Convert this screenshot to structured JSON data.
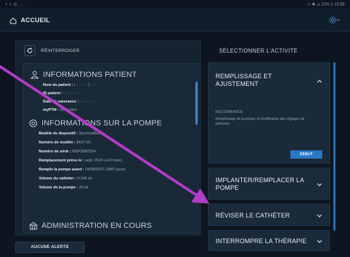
{
  "statusbar": {
    "left": "▪ ▪ ◎ ...",
    "right": "◐ ✱ ⊿ 12% ▯ 15:58"
  },
  "appbar": {
    "title": "ACCUEIL",
    "home_icon": "home-icon",
    "settings_icon": "gear-icon"
  },
  "left": {
    "reinterroger_label": "RÉINTERROGER",
    "patient": {
      "title": "INFORMATIONS PATIENT",
      "rows": [
        {
          "label": "Nom du patient :",
          "value": " ( · · · · · ) · · ·"
        },
        {
          "label": "ID patient :",
          "value": " - - - - - -"
        },
        {
          "label": "Date de naissance :",
          "value": " - - - - - -"
        },
        {
          "label": "myPTM :",
          "value": " Désactivé"
        }
      ]
    },
    "pump": {
      "title": "INFORMATIONS SUR LA POMPE",
      "rows": [
        {
          "label": "Modèle de dispositif :",
          "value": " SynchroMed"
        },
        {
          "label": "Numéro de modèle :",
          "value": " 8637-20"
        },
        {
          "label": "Numéro de série :",
          "value": " NGP358031H"
        },
        {
          "label": "Remplacement prévu le :",
          "value": " sept. 2024 (+63 mois)"
        },
        {
          "label": "Remplir la pompe avant :",
          "value": " 24/06/2027 (2887 jours)"
        },
        {
          "label": "Volume du cathéter :",
          "value": " 0,196 ml"
        },
        {
          "label": "Volume de la pompe :",
          "value": " 20 ml"
        }
      ]
    },
    "admin": {
      "title": "ADMINISTRATION EN COURS"
    },
    "alert_button": "AUCUNE ALERTE"
  },
  "right": {
    "title": "SÉLECTIONNER L'ACTIVITÉ",
    "activities": [
      {
        "label_line1": "REMPLISSAGE ET",
        "label_line2": "AJUSTEMENT",
        "expanded": true,
        "recommended": "RECOMMANDÉ",
        "description": "Remplissage de la pompe et modification des réglages de perfusion",
        "start_button": "DÉBUT"
      },
      {
        "label_line1": "IMPLANTER/REMPLACER LA",
        "label_line2": "POMPE",
        "expanded": false
      },
      {
        "label_line1": "RÉVISER LE CATHÉTER",
        "expanded": false
      },
      {
        "label_line1": "INTERROMPRE LA THÉRAPIE",
        "expanded": false
      }
    ]
  },
  "colors": {
    "background": "#0d1620",
    "panel": "#1a2938",
    "accent": "#2a78c6",
    "annotation_arrow": "#b23cc8"
  }
}
